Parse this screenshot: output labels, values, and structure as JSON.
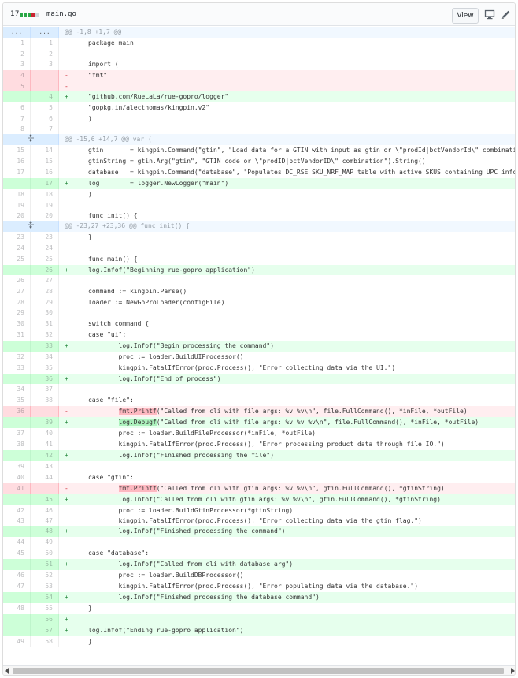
{
  "file": {
    "changes": "17",
    "name": "main.go",
    "view_label": "View"
  },
  "colors": {
    "add": "#28a745",
    "del": "#cb2431",
    "neutral": "#d1d5da"
  },
  "hunks": {
    "top": {
      "left": "...",
      "right": "...",
      "text": "@@ -1,8 +1,7 @@"
    }
  },
  "rows": [
    {
      "t": "hunk",
      "o": "...",
      "n": "...",
      "c": "@@ -1,8 +1,7 @@"
    },
    {
      "t": "ctx",
      "o": "1",
      "n": "1",
      "c": "package main"
    },
    {
      "t": "ctx",
      "o": "2",
      "n": "2",
      "c": ""
    },
    {
      "t": "ctx",
      "o": "3",
      "n": "3",
      "c": "import ("
    },
    {
      "t": "del",
      "o": "4",
      "n": "",
      "c": "        \"fmt\""
    },
    {
      "t": "del",
      "o": "5",
      "n": "",
      "c": ""
    },
    {
      "t": "add",
      "o": "",
      "n": "4",
      "c": "        \"github.com/RueLaLa/rue-gopro/logger\""
    },
    {
      "t": "ctx",
      "o": "6",
      "n": "5",
      "c": "        \"gopkg.in/alecthomas/kingpin.v2\""
    },
    {
      "t": "ctx",
      "o": "7",
      "n": "6",
      "c": ")"
    },
    {
      "t": "ctx",
      "o": "8",
      "n": "7",
      "c": ""
    },
    {
      "t": "hunk",
      "o": "exp",
      "n": "",
      "c": "@@ -15,6 +14,7 @@ var ("
    },
    {
      "t": "ctx",
      "o": "15",
      "n": "14",
      "c": "        gtin       = kingpin.Command(\"gtin\", \"Load data for a GTIN with input as gtin or \\\"prodId|bctVendorId\\\" combination.\")"
    },
    {
      "t": "ctx",
      "o": "16",
      "n": "15",
      "c": "        gtinString = gtin.Arg(\"gtin\", \"GTIN code or \\\"prodID|bctVendorID\\\" combination\").String()"
    },
    {
      "t": "ctx",
      "o": "17",
      "n": "16",
      "c": "        database   = kingpin.Command(\"database\", \"Populates DC_RSE SKU_NRF_MAP table with active SKUS containing UPC information\")"
    },
    {
      "t": "add",
      "o": "",
      "n": "17",
      "c": "        log        = logger.NewLogger(\"main\")"
    },
    {
      "t": "ctx",
      "o": "18",
      "n": "18",
      "c": ")"
    },
    {
      "t": "ctx",
      "o": "19",
      "n": "19",
      "c": ""
    },
    {
      "t": "ctx",
      "o": "20",
      "n": "20",
      "c": "func init() {"
    },
    {
      "t": "hunk",
      "o": "exp",
      "n": "",
      "c": "@@ -23,27 +23,36 @@ func init() {"
    },
    {
      "t": "ctx",
      "o": "23",
      "n": "23",
      "c": "}"
    },
    {
      "t": "ctx",
      "o": "24",
      "n": "24",
      "c": ""
    },
    {
      "t": "ctx",
      "o": "25",
      "n": "25",
      "c": "func main() {"
    },
    {
      "t": "add",
      "o": "",
      "n": "26",
      "c": "        log.Infof(\"Beginning rue-gopro application\")"
    },
    {
      "t": "ctx",
      "o": "26",
      "n": "27",
      "c": ""
    },
    {
      "t": "ctx",
      "o": "27",
      "n": "28",
      "c": "        command := kingpin.Parse()"
    },
    {
      "t": "ctx",
      "o": "28",
      "n": "29",
      "c": "        loader := NewGoProLoader(configFile)"
    },
    {
      "t": "ctx",
      "o": "29",
      "n": "30",
      "c": ""
    },
    {
      "t": "ctx",
      "o": "30",
      "n": "31",
      "c": "        switch command {"
    },
    {
      "t": "ctx",
      "o": "31",
      "n": "32",
      "c": "        case \"ui\":"
    },
    {
      "t": "add",
      "o": "",
      "n": "33",
      "c": "                log.Infof(\"Begin processing the command\")"
    },
    {
      "t": "ctx",
      "o": "32",
      "n": "34",
      "c": "                proc := loader.BuildUIProcessor()"
    },
    {
      "t": "ctx",
      "o": "33",
      "n": "35",
      "c": "                kingpin.FatalIfError(proc.Process(), \"Error collecting data via the UI.\")"
    },
    {
      "t": "add",
      "o": "",
      "n": "36",
      "c": "                log.Infof(\"End of process\")"
    },
    {
      "t": "ctx",
      "o": "34",
      "n": "37",
      "c": ""
    },
    {
      "t": "ctx",
      "o": "35",
      "n": "38",
      "c": "        case \"file\":"
    },
    {
      "t": "del",
      "o": "36",
      "n": "",
      "c": "                fmt.Printf(\"Called from cli with file args: %v %v\\n\", file.FullCommand(), *inFile, *outFile)"
    },
    {
      "t": "add",
      "o": "",
      "n": "39",
      "c": "                log.Debugf(\"Called from cli with file args: %v %v %v\\n\", file.FullCommand(), *inFile, *outFile)"
    },
    {
      "t": "ctx",
      "o": "37",
      "n": "40",
      "c": "                proc := loader.BuildFileProcessor(*inFile, *outFile)"
    },
    {
      "t": "ctx",
      "o": "38",
      "n": "41",
      "c": "                kingpin.FatalIfError(proc.Process(), \"Error processing product data through file IO.\")"
    },
    {
      "t": "add",
      "o": "",
      "n": "42",
      "c": "                log.Infof(\"Finished processing the file\")"
    },
    {
      "t": "ctx",
      "o": "39",
      "n": "43",
      "c": ""
    },
    {
      "t": "ctx",
      "o": "40",
      "n": "44",
      "c": "        case \"gtin\":"
    },
    {
      "t": "del",
      "o": "41",
      "n": "",
      "c": "                fmt.Printf(\"Called from cli with gtin args: %v %v\\n\", gtin.FullCommand(), *gtinString)"
    },
    {
      "t": "add",
      "o": "",
      "n": "45",
      "c": "                log.Infof(\"Called from cli with gtin args: %v %v\\n\", gtin.FullCommand(), *gtinString)"
    },
    {
      "t": "ctx",
      "o": "42",
      "n": "46",
      "c": "                proc := loader.BuildGtinProcessor(*gtinString)"
    },
    {
      "t": "ctx",
      "o": "43",
      "n": "47",
      "c": "                kingpin.FatalIfError(proc.Process(), \"Error collecting data via the gtin flag.\")"
    },
    {
      "t": "add",
      "o": "",
      "n": "48",
      "c": "                log.Infof(\"Finished processing the command\")"
    },
    {
      "t": "ctx",
      "o": "44",
      "n": "49",
      "c": ""
    },
    {
      "t": "ctx",
      "o": "45",
      "n": "50",
      "c": "        case \"database\":"
    },
    {
      "t": "add",
      "o": "",
      "n": "51",
      "c": "                log.Infof(\"Called from cli with database arg\")"
    },
    {
      "t": "ctx",
      "o": "46",
      "n": "52",
      "c": "                proc := loader.BuildDBProcessor()"
    },
    {
      "t": "ctx",
      "o": "47",
      "n": "53",
      "c": "                kingpin.FatalIfError(proc.Process(), \"Error populating data via the database.\")"
    },
    {
      "t": "add",
      "o": "",
      "n": "54",
      "c": "                log.Infof(\"Finished processing the database command\")"
    },
    {
      "t": "ctx",
      "o": "48",
      "n": "55",
      "c": "        }"
    },
    {
      "t": "add",
      "o": "",
      "n": "56",
      "c": ""
    },
    {
      "t": "add",
      "o": "",
      "n": "57",
      "c": "        log.Infof(\"Ending rue-gopro application\")"
    },
    {
      "t": "ctx",
      "o": "49",
      "n": "58",
      "c": "}"
    }
  ]
}
